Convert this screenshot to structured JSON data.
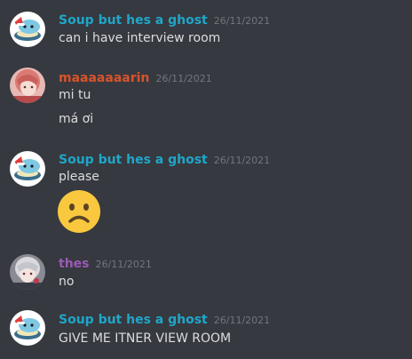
{
  "colors": {
    "background": "#36393f",
    "soup_username": "#1fa6c9",
    "maaaa_username": "#d8532c",
    "thes_username": "#9b59b6",
    "text": "#dcddde",
    "timestamp": "#72767d"
  },
  "messages": [
    {
      "username": "Soup but hes a ghost",
      "timestamp": "26/11/2021",
      "avatar": "ghost-soup-santa-hat-icon",
      "lines": [
        "can i have interview room"
      ]
    },
    {
      "username": "maaaaaaarin",
      "timestamp": "26/11/2021",
      "avatar": "anime-girl-avatar",
      "lines": [
        "mi tu",
        "má ơi"
      ]
    },
    {
      "username": "Soup but hes a ghost",
      "timestamp": "26/11/2021",
      "avatar": "ghost-soup-santa-hat-icon",
      "lines": [
        "please"
      ],
      "emoji": "frowning-face-emoji"
    },
    {
      "username": "thes",
      "timestamp": "26/11/2021",
      "avatar": "anime-character-avatar",
      "lines": [
        "no"
      ]
    },
    {
      "username": "Soup but hes a ghost",
      "timestamp": "26/11/2021",
      "avatar": "ghost-soup-santa-hat-icon",
      "lines": [
        "GIVE ME ITNER VIEW ROOM"
      ]
    }
  ]
}
